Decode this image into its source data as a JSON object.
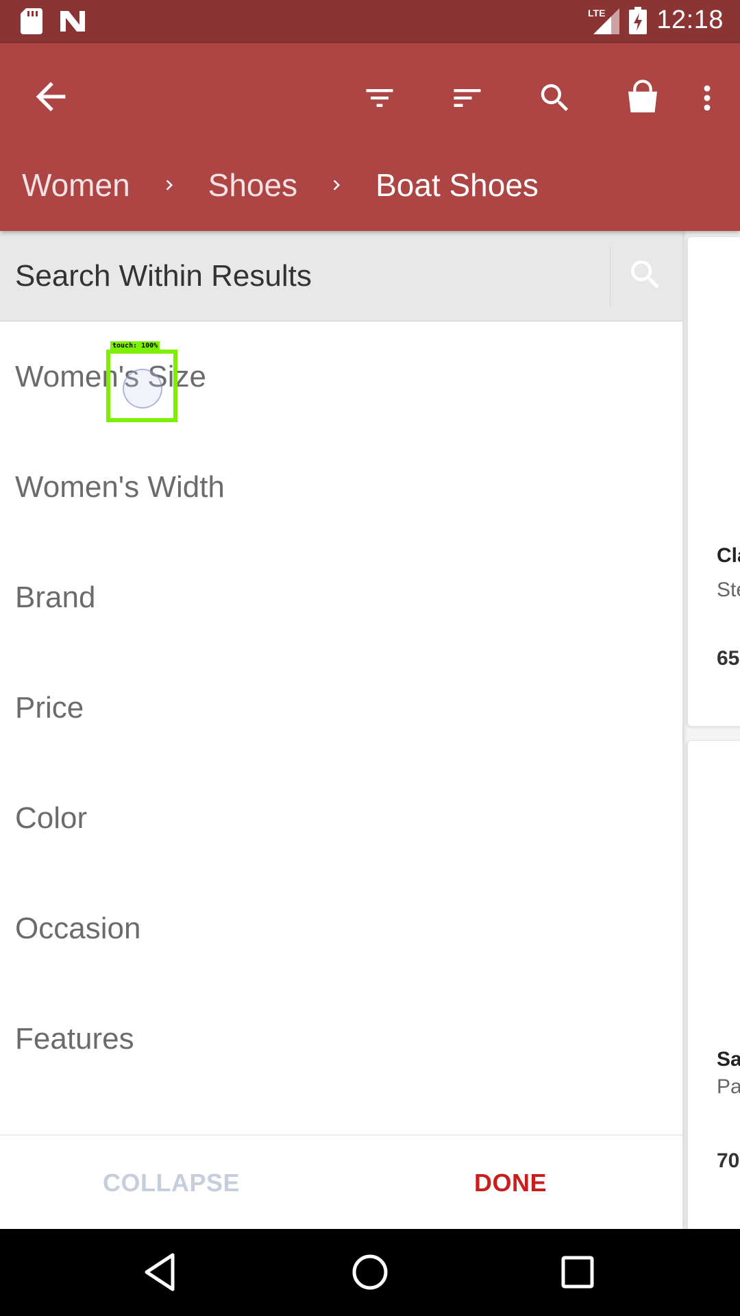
{
  "status_bar": {
    "time": "12:18",
    "network": "LTE",
    "icons": [
      "sd-card-icon",
      "n-notification-icon",
      "signal-icon",
      "battery-charging-icon"
    ]
  },
  "app_bar": {
    "colors": {
      "background": "#ae4545",
      "status_bar": "#8a3434"
    },
    "icons": [
      "back-arrow-icon",
      "filter-icon",
      "sort-icon",
      "search-icon",
      "shopping-bag-icon",
      "more-vert-icon"
    ]
  },
  "breadcrumb": {
    "items": [
      "Women",
      "Shoes",
      "Boat Shoes"
    ]
  },
  "search": {
    "placeholder": "Search Within Results"
  },
  "filters": {
    "items": [
      "Women's Size",
      "Women's Width",
      "Brand",
      "Price",
      "Color",
      "Occasion",
      "Features"
    ]
  },
  "touch_indicator": {
    "label": "touch: 100%"
  },
  "bottom_actions": {
    "collapse_label": "COLLAPSE",
    "done_label": "DONE",
    "colors": {
      "collapse": "#c7cedb",
      "done": "#c81e1e"
    }
  },
  "products": [
    {
      "name": "Cla",
      "brand": "Ste",
      "price": "65"
    },
    {
      "name": "Sa",
      "brand": "Pa",
      "price": "70"
    }
  ],
  "nav_bar": {
    "icons": [
      "nav-back-icon",
      "nav-home-icon",
      "nav-recents-icon"
    ]
  }
}
